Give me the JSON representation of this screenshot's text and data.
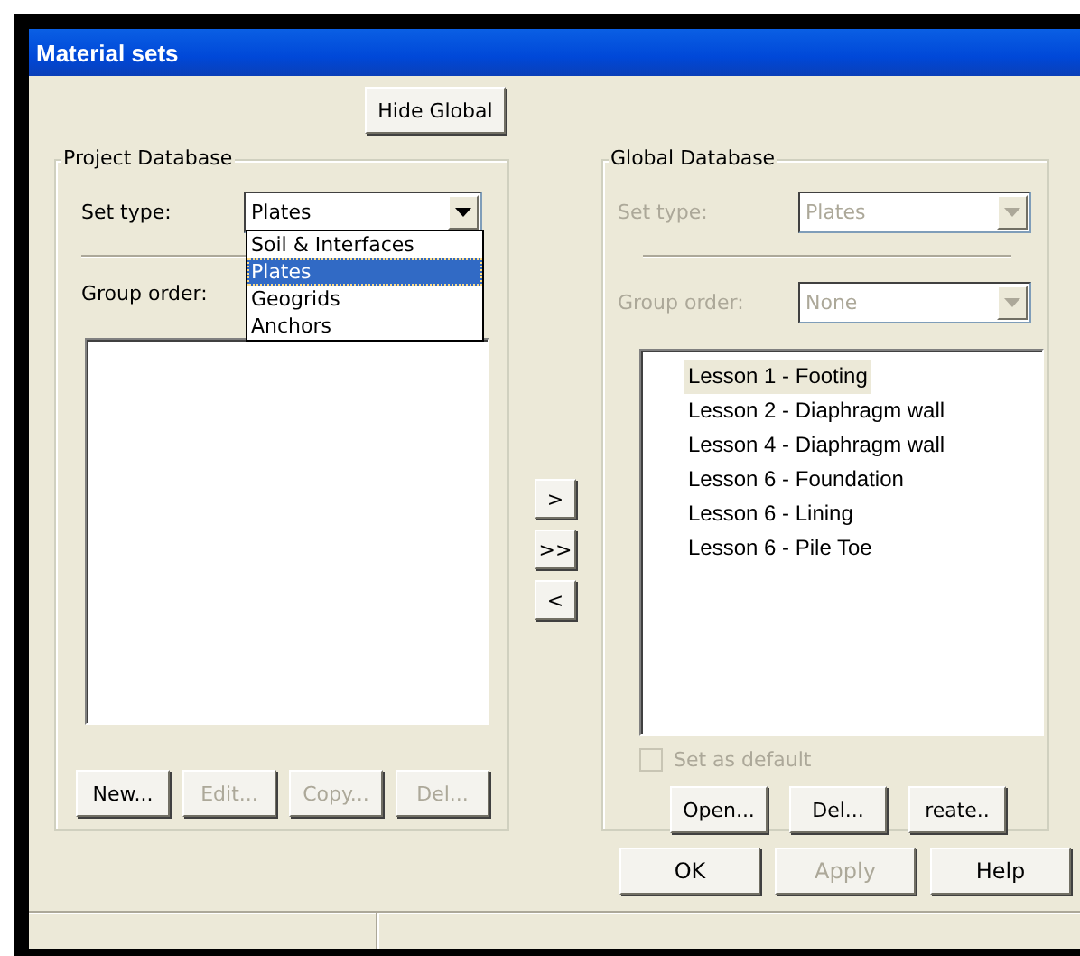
{
  "window": {
    "title": "Material sets"
  },
  "hide_global_button": {
    "label": "Hide Global"
  },
  "project_database": {
    "title": "Project Database",
    "set_type": {
      "label": "Set type:",
      "value": "Plates",
      "expanded": true,
      "options": [
        {
          "label": "Soil & Interfaces",
          "selected": false
        },
        {
          "label": "Plates",
          "selected": true
        },
        {
          "label": "Geogrids",
          "selected": false
        },
        {
          "label": "Anchors",
          "selected": false
        }
      ]
    },
    "group_order": {
      "label": "Group order:"
    },
    "buttons": [
      {
        "label": "New...",
        "disabled": false
      },
      {
        "label": "Edit...",
        "disabled": true
      },
      {
        "label": "Copy...",
        "disabled": true
      },
      {
        "label": "Del...",
        "disabled": true
      }
    ]
  },
  "transfer_buttons": [
    {
      "label": ">"
    },
    {
      "label": ">>"
    },
    {
      "label": "<"
    }
  ],
  "global_database": {
    "title": "Global Database",
    "set_type": {
      "label": "Set type:",
      "value": "Plates",
      "disabled": true
    },
    "group_order": {
      "label": "Group order:",
      "value": "None",
      "disabled": true
    },
    "items": [
      {
        "label": "Lesson 1 - Footing",
        "selected": true
      },
      {
        "label": "Lesson 2 - Diaphragm wall",
        "selected": false
      },
      {
        "label": "Lesson 4 - Diaphragm wall",
        "selected": false
      },
      {
        "label": "Lesson 6 - Foundation",
        "selected": false
      },
      {
        "label": "Lesson 6 - Lining",
        "selected": false
      },
      {
        "label": "Lesson 6 - Pile Toe",
        "selected": false
      }
    ],
    "set_as_default": {
      "label": "Set as default",
      "checked": false,
      "disabled": true
    },
    "buttons": [
      {
        "label": "Open...",
        "disabled": false
      },
      {
        "label": "Del...",
        "disabled": false
      },
      {
        "label": "reate..",
        "disabled": false
      }
    ]
  },
  "dialog_buttons": [
    {
      "label": "OK",
      "disabled": false
    },
    {
      "label": "Apply",
      "disabled": true
    },
    {
      "label": "Help",
      "disabled": false
    }
  ]
}
